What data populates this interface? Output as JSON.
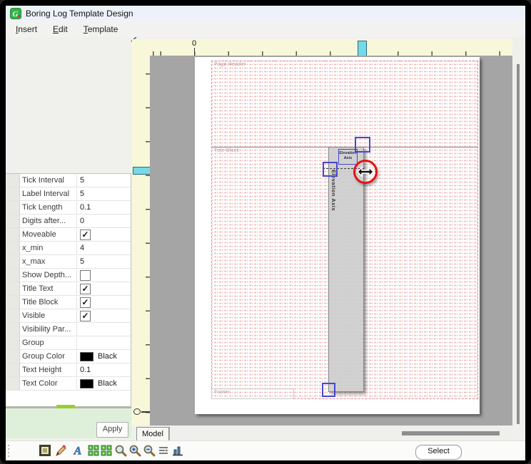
{
  "window": {
    "title": "Boring Log Template Design"
  },
  "menu": {
    "items": [
      {
        "key": "I",
        "rest": "nsert"
      },
      {
        "key": "E",
        "rest": "dit"
      },
      {
        "key": "T",
        "rest": "emplate"
      }
    ]
  },
  "properties": {
    "rows": [
      {
        "label": "Tick Interval",
        "value": "5"
      },
      {
        "label": "Label Interval",
        "value": "5"
      },
      {
        "label": "Tick Length",
        "value": "0.1"
      },
      {
        "label": "Digits  after...",
        "value": "0"
      },
      {
        "label": "Moveable",
        "check": "✓"
      },
      {
        "label": "x_min",
        "value": "4"
      },
      {
        "label": "x_max",
        "value": "5"
      },
      {
        "label": "Show  Depth...",
        "check": ""
      },
      {
        "label": "Title Text",
        "check": "✓"
      },
      {
        "label": "Title Block",
        "check": "✓"
      },
      {
        "label": "Visible",
        "check": "✓"
      },
      {
        "label": "Visibility Par...",
        "value": ""
      },
      {
        "label": "Group",
        "value": ""
      },
      {
        "label": "Group Color",
        "color_name": "Black",
        "swatch": "#000000"
      },
      {
        "label": "Text Height",
        "value": "0.1"
      },
      {
        "label": "Text Color",
        "color_name": "Black",
        "swatch": "#000000"
      }
    ],
    "apply_label": "Apply"
  },
  "canvas": {
    "h_ruler_zero": "0",
    "page": {
      "header_label": "Page Header",
      "title_block_label": "Title Block",
      "footer_label": "Footer"
    },
    "selection": {
      "label_line1": "Elevation",
      "label_line2": "Axis",
      "vertical_label": "Elevation Axis"
    }
  },
  "tabs": {
    "model_label": "Model"
  },
  "footer_bar": {
    "select_label": "Select"
  },
  "toolbar": {
    "icons": [
      "frame-select",
      "pencil",
      "text",
      "grid-green-1",
      "grid-green-2",
      "zoom",
      "zoom-in",
      "zoom-out",
      "align-list",
      "chart"
    ]
  },
  "colors": {
    "ruler": "#f8f7da",
    "canvas_gray": "#a5a5a5",
    "grid_dot_red": "#d54646",
    "selection_blue": "#4646cf",
    "selection_red": "#e51212",
    "marker_cyan": "#74d9e8",
    "apply_panel_green": "#dff0da",
    "accent_green": "#9acd32"
  }
}
